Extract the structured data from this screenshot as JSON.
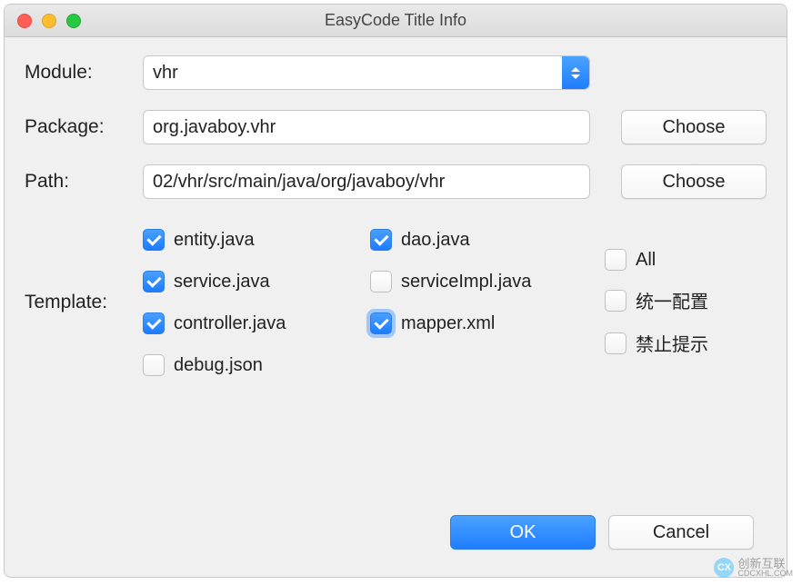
{
  "window": {
    "title": "EasyCode Title Info"
  },
  "labels": {
    "module": "Module:",
    "package": "Package:",
    "path": "Path:",
    "template": "Template:"
  },
  "fields": {
    "module_value": "vhr",
    "package_value": "org.javaboy.vhr",
    "path_value": "02/vhr/src/main/java/org/javaboy/vhr"
  },
  "buttons": {
    "choose": "Choose",
    "ok": "OK",
    "cancel": "Cancel"
  },
  "templates": [
    {
      "label": "entity.java",
      "checked": true,
      "focused": false
    },
    {
      "label": "dao.java",
      "checked": true,
      "focused": false
    },
    {
      "label": "service.java",
      "checked": true,
      "focused": false
    },
    {
      "label": "serviceImpl.java",
      "checked": false,
      "focused": false
    },
    {
      "label": "controller.java",
      "checked": true,
      "focused": false
    },
    {
      "label": "mapper.xml",
      "checked": true,
      "focused": true
    },
    {
      "label": "debug.json",
      "checked": false,
      "focused": false
    }
  ],
  "side_options": [
    {
      "label": "All",
      "checked": false
    },
    {
      "label": "统一配置",
      "checked": false
    },
    {
      "label": "禁止提示",
      "checked": false
    }
  ],
  "watermark": {
    "logo_text": "CX",
    "cn": "创新互联",
    "en": "CDCXHL.COM"
  }
}
